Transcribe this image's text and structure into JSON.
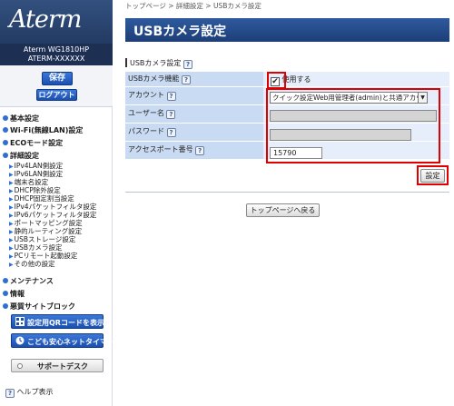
{
  "brand": {
    "logo": "Aterm",
    "model": "Aterm WG1810HP",
    "device_id": "ATERM-XXXXXX"
  },
  "sidebar": {
    "save_label": "保存",
    "logout_label": "ログアウト",
    "nav": [
      {
        "label": "基本設定"
      },
      {
        "label": "Wi-Fi(無線LAN)設定"
      },
      {
        "label": "ECOモード設定"
      },
      {
        "label": "詳細設定"
      },
      {
        "label": "メンテナンス"
      },
      {
        "label": "情報"
      },
      {
        "label": "悪質サイトブロック"
      }
    ],
    "sub_items": [
      "IPv4LAN側設定",
      "IPv6LAN側設定",
      "端末名設定",
      "DHCP除外設定",
      "DHCP固定割当設定",
      "IPv4パケットフィルタ設定",
      "IPv6パケットフィルタ設定",
      "ポートマッピング設定",
      "静的ルーティング設定",
      "USBストレージ設定",
      "USBカメラ設定",
      "PCリモート起動設定",
      "その他の設定"
    ],
    "qr_button": "設定用QRコードを表示",
    "timer_button": "こども安心ネットタイマー",
    "support_button": "サポートデスク",
    "help_label": "ヘルプ表示"
  },
  "breadcrumb": "トップページ > 詳細設定 > USBカメラ設定",
  "page_title": "USBカメラ設定",
  "section_label": "USBカメラ設定",
  "form": {
    "camera_feature_label": "USBカメラ機能",
    "camera_feature_checkbox": "使用する",
    "camera_feature_checked": true,
    "account_label": "アカウント",
    "account_value": "クイック設定Web用管理者(admin)と共通アカウント",
    "username_label": "ユーザー名",
    "username_value": "",
    "password_label": "パスワード",
    "password_value": "",
    "port_label": "アクセスポート番号",
    "port_value": "15790"
  },
  "set_button": "設定",
  "top_button": "トップページへ戻る",
  "help_icon": "?",
  "colors": {
    "header_blue": "#2f5a9e",
    "label_bg": "#c9dbf2",
    "value_bg": "#e5eefa",
    "highlight_red": "#e00000"
  }
}
